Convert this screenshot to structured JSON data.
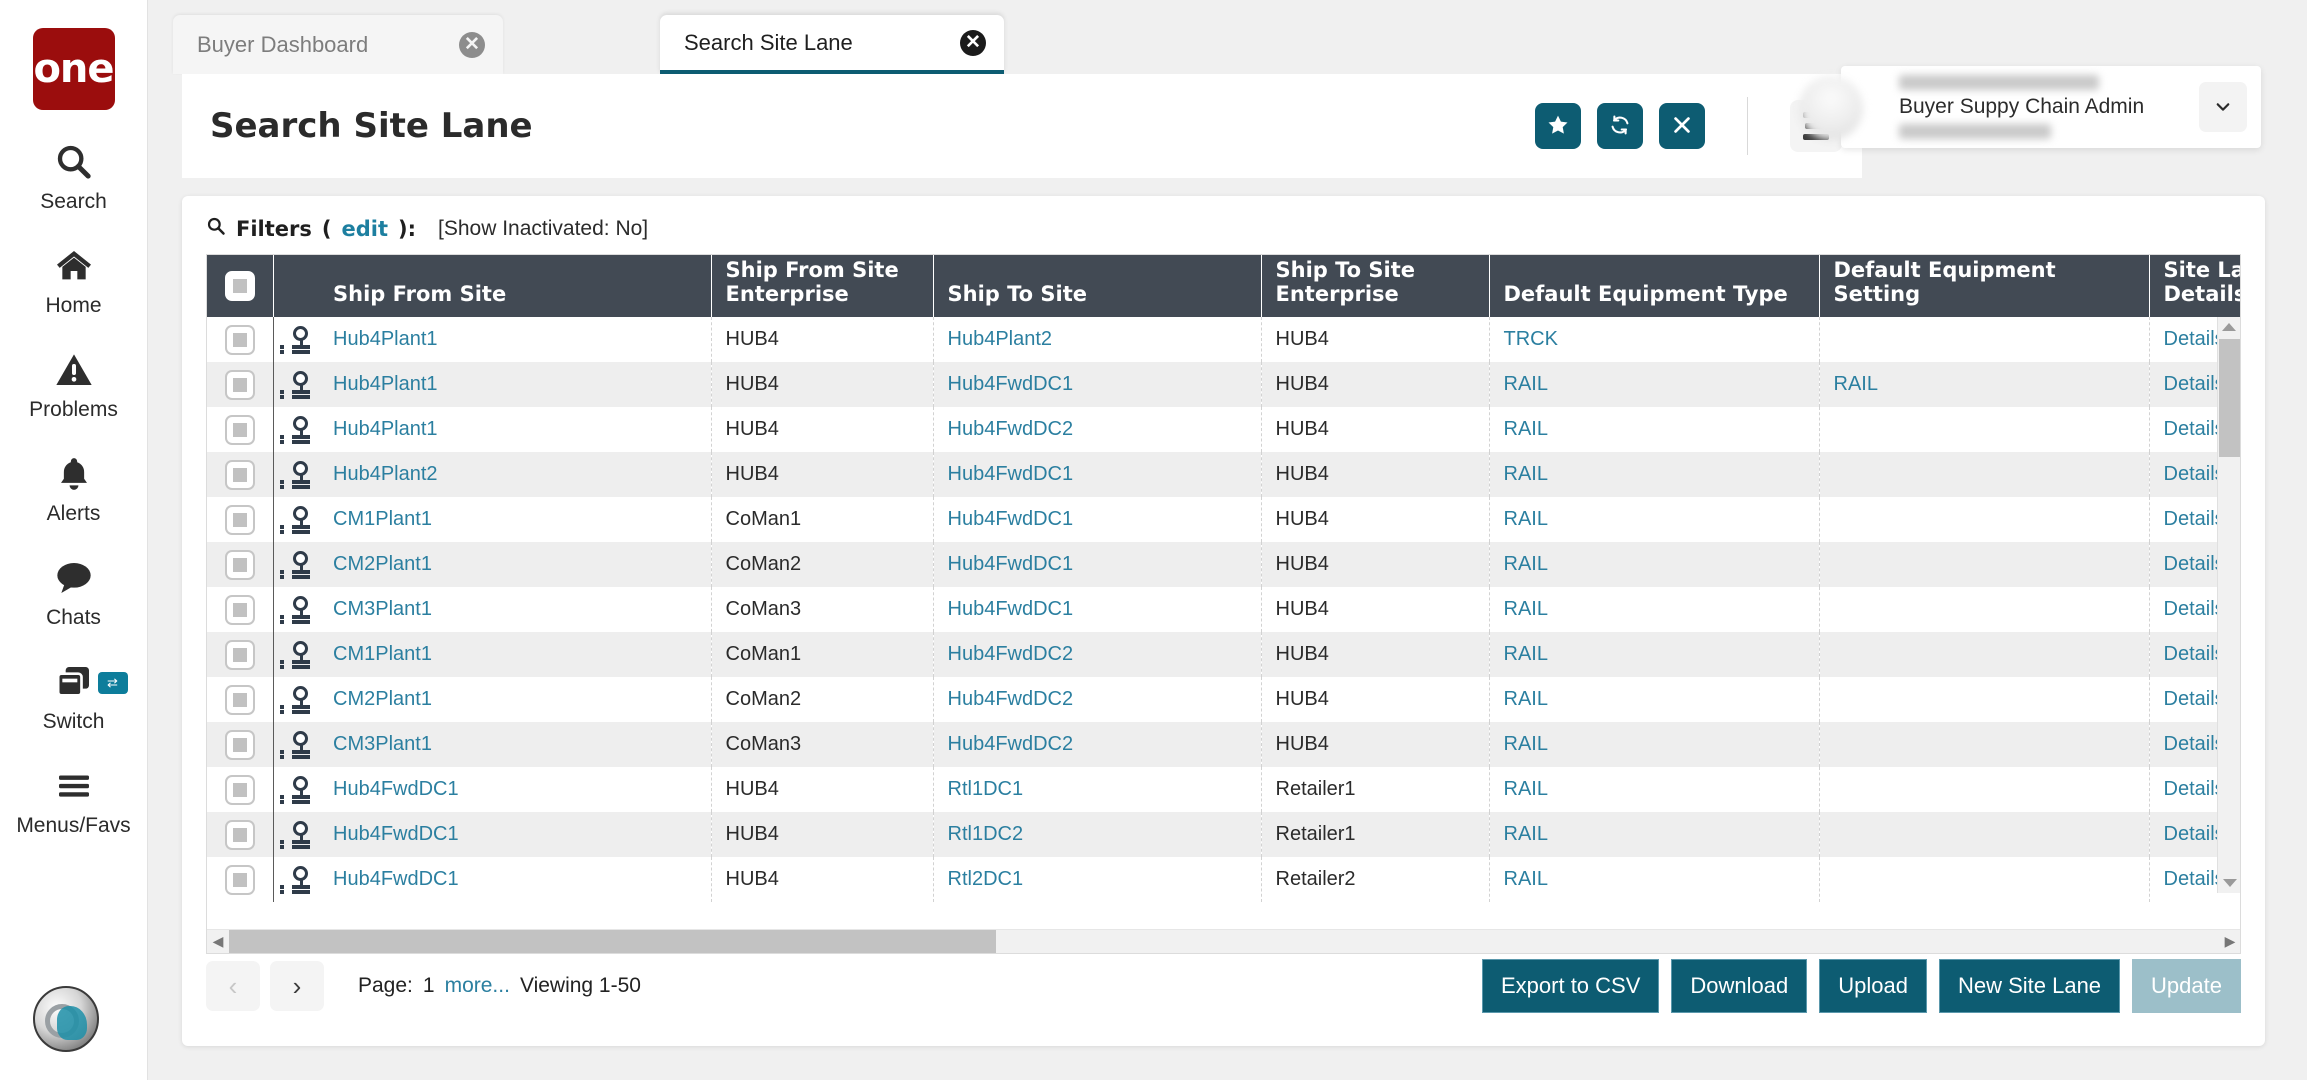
{
  "brand": {
    "logo_text": "one",
    "logo_color": "#9b0d0d"
  },
  "theme": {
    "accent": "#0d5c72",
    "header_row": "#424a54",
    "link": "#2b7fa0",
    "badge": "#8e0b16"
  },
  "rail": {
    "items": [
      {
        "label": "Search",
        "icon": "search-icon"
      },
      {
        "label": "Home",
        "icon": "home-icon"
      },
      {
        "label": "Problems",
        "icon": "warning-triangle-icon"
      },
      {
        "label": "Alerts",
        "icon": "bell-icon"
      },
      {
        "label": "Chats",
        "icon": "chat-bubble-icon"
      },
      {
        "label": "Switch",
        "icon": "windows-switch-icon",
        "badge_icon": "swap-arrows-icon"
      },
      {
        "label": "Menus/Favs",
        "icon": "hamburger-icon"
      }
    ],
    "assistant_avatar": "assistant-avatar"
  },
  "tabs": [
    {
      "label": "Buyer Dashboard",
      "active": false,
      "close_icon": "close-circle-icon"
    },
    {
      "label": "Search Site Lane",
      "active": true,
      "close_icon": "close-circle-icon"
    }
  ],
  "header": {
    "title": "Search Site Lane",
    "actions": [
      {
        "name": "favorite-button",
        "icon": "star-icon"
      },
      {
        "name": "refresh-button",
        "icon": "refresh-icon"
      },
      {
        "name": "close-button",
        "icon": "x-icon"
      }
    ],
    "menu_button": {
      "icon": "hamburger-icon",
      "badge_icon": "star-icon"
    }
  },
  "user": {
    "role": "Buyer Suppy Chain Admin",
    "chevron_icon": "chevron-down-icon"
  },
  "filters": {
    "icon": "search-icon",
    "label": "Filters",
    "edit_label": "edit",
    "open_paren": "(",
    "close_paren": "):",
    "show_inactivated": "[Show Inactivated: No]"
  },
  "table": {
    "select_all_checkbox": "checkbox",
    "columns": [
      "Ship From Site",
      "Ship From Site Enterprise",
      "Ship To Site",
      "Ship To Site Enterprise",
      "Default Equipment Type",
      "Default Equipment Setting",
      "Site Lane Details"
    ],
    "rows": [
      {
        "ship_from_site": "Hub4Plant1",
        "ship_from_ent": "HUB4",
        "ship_to_site": "Hub4Plant2",
        "ship_to_ent": "HUB4",
        "equip_type": "TRCK",
        "equip_setting": "",
        "details": "Details"
      },
      {
        "ship_from_site": "Hub4Plant1",
        "ship_from_ent": "HUB4",
        "ship_to_site": "Hub4FwdDC1",
        "ship_to_ent": "HUB4",
        "equip_type": "RAIL",
        "equip_setting": "RAIL",
        "details": "Details"
      },
      {
        "ship_from_site": "Hub4Plant1",
        "ship_from_ent": "HUB4",
        "ship_to_site": "Hub4FwdDC2",
        "ship_to_ent": "HUB4",
        "equip_type": "RAIL",
        "equip_setting": "",
        "details": "Details"
      },
      {
        "ship_from_site": "Hub4Plant2",
        "ship_from_ent": "HUB4",
        "ship_to_site": "Hub4FwdDC1",
        "ship_to_ent": "HUB4",
        "equip_type": "RAIL",
        "equip_setting": "",
        "details": "Details"
      },
      {
        "ship_from_site": "CM1Plant1",
        "ship_from_ent": "CoMan1",
        "ship_to_site": "Hub4FwdDC1",
        "ship_to_ent": "HUB4",
        "equip_type": "RAIL",
        "equip_setting": "",
        "details": "Details"
      },
      {
        "ship_from_site": "CM2Plant1",
        "ship_from_ent": "CoMan2",
        "ship_to_site": "Hub4FwdDC1",
        "ship_to_ent": "HUB4",
        "equip_type": "RAIL",
        "equip_setting": "",
        "details": "Details"
      },
      {
        "ship_from_site": "CM3Plant1",
        "ship_from_ent": "CoMan3",
        "ship_to_site": "Hub4FwdDC1",
        "ship_to_ent": "HUB4",
        "equip_type": "RAIL",
        "equip_setting": "",
        "details": "Details"
      },
      {
        "ship_from_site": "CM1Plant1",
        "ship_from_ent": "CoMan1",
        "ship_to_site": "Hub4FwdDC2",
        "ship_to_ent": "HUB4",
        "equip_type": "RAIL",
        "equip_setting": "",
        "details": "Details"
      },
      {
        "ship_from_site": "CM2Plant1",
        "ship_from_ent": "CoMan2",
        "ship_to_site": "Hub4FwdDC2",
        "ship_to_ent": "HUB4",
        "equip_type": "RAIL",
        "equip_setting": "",
        "details": "Details"
      },
      {
        "ship_from_site": "CM3Plant1",
        "ship_from_ent": "CoMan3",
        "ship_to_site": "Hub4FwdDC2",
        "ship_to_ent": "HUB4",
        "equip_type": "RAIL",
        "equip_setting": "",
        "details": "Details"
      },
      {
        "ship_from_site": "Hub4FwdDC1",
        "ship_from_ent": "HUB4",
        "ship_to_site": "Rtl1DC1",
        "ship_to_ent": "Retailer1",
        "equip_type": "RAIL",
        "equip_setting": "",
        "details": "Details"
      },
      {
        "ship_from_site": "Hub4FwdDC1",
        "ship_from_ent": "HUB4",
        "ship_to_site": "Rtl1DC2",
        "ship_to_ent": "Retailer1",
        "equip_type": "RAIL",
        "equip_setting": "",
        "details": "Details"
      },
      {
        "ship_from_site": "Hub4FwdDC1",
        "ship_from_ent": "HUB4",
        "ship_to_site": "Rtl2DC1",
        "ship_to_ent": "Retailer2",
        "equip_type": "RAIL",
        "equip_setting": "",
        "details": "Details"
      }
    ]
  },
  "footer": {
    "prev_icon": "chevron-left-icon",
    "next_icon": "chevron-right-icon",
    "page_label": "Page:",
    "page_number": "1",
    "more_label": "more...",
    "viewing_label": "Viewing 1-50",
    "buttons": [
      {
        "label": "Export to CSV",
        "disabled": false
      },
      {
        "label": "Download",
        "disabled": false
      },
      {
        "label": "Upload",
        "disabled": false
      },
      {
        "label": "New Site Lane",
        "disabled": false
      },
      {
        "label": "Update",
        "disabled": true
      }
    ]
  }
}
